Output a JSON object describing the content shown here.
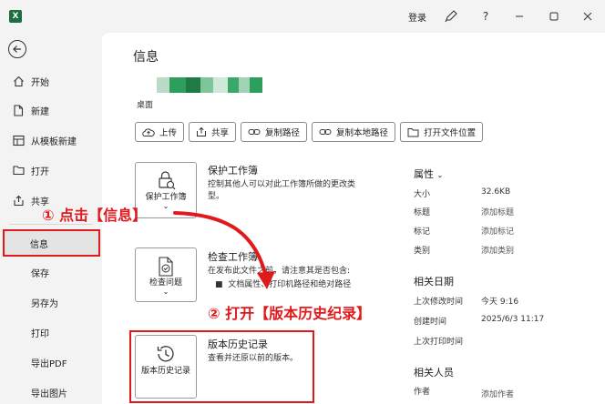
{
  "titlebar": {
    "login_label": "登录",
    "icons": [
      "excel-logo",
      "pen-icon",
      "help-icon",
      "minimize-icon",
      "restore-icon",
      "close-icon"
    ]
  },
  "sidebar": {
    "items": [
      {
        "label": "开始",
        "icon": "home-icon"
      },
      {
        "label": "新建",
        "icon": "new-doc-icon"
      },
      {
        "label": "从模板新建",
        "icon": "template-icon"
      },
      {
        "label": "打开",
        "icon": "folder-icon"
      },
      {
        "label": "共享",
        "icon": "share-icon"
      },
      {
        "label": "信息",
        "icon": ""
      },
      {
        "label": "保存",
        "icon": ""
      },
      {
        "label": "另存为",
        "icon": ""
      },
      {
        "label": "打印",
        "icon": ""
      },
      {
        "label": "导出PDF",
        "icon": ""
      },
      {
        "label": "导出图片",
        "icon": ""
      }
    ],
    "active": "信息"
  },
  "main": {
    "title": "信息",
    "location": "桌面",
    "actions": [
      "上传",
      "共享",
      "复制路径",
      "复制本地路径",
      "打开文件位置"
    ],
    "protect": {
      "button": "保护工作簿",
      "heading": "保护工作簿",
      "description": "控制其他人可以对此工作簿所做的更改类型。"
    },
    "inspect": {
      "button": "检查问题",
      "heading": "检查工作簿",
      "intro": "在发布此文件之前，请注意其是否包含:",
      "bullet": "文档属性、打印机路径和绝对路径"
    },
    "history": {
      "button": "版本历史记录",
      "heading": "版本历史记录",
      "description": "查看并还原以前的版本。"
    }
  },
  "properties": {
    "heading": "属性",
    "rows": [
      {
        "key": "大小",
        "value": "32.6KB"
      },
      {
        "key": "标题",
        "value": "添加标题"
      },
      {
        "key": "标记",
        "value": "添加标记"
      },
      {
        "key": "类别",
        "value": "添加类别"
      }
    ],
    "dates_heading": "相关日期",
    "dates": [
      {
        "key": "上次修改时间",
        "value": "今天 9:16"
      },
      {
        "key": "创建时间",
        "value": "2025/6/3 11:17"
      },
      {
        "key": "上次打印时间",
        "value": ""
      }
    ],
    "people_heading": "相关人员",
    "people": [
      {
        "key": "作者",
        "value": "添加作者"
      }
    ]
  },
  "annotations": {
    "step1": "① 点击【信息】",
    "step2": "② 打开【版本历史纪录】"
  },
  "colors": {
    "highlight": "#e0191c",
    "excel_green": "#1d6f42",
    "blur_bar": [
      "#b8dcc6",
      "#2e9e5c",
      "#1f7a45",
      "#7fc49a",
      "#cfe9d9",
      "#3aa86a"
    ]
  }
}
